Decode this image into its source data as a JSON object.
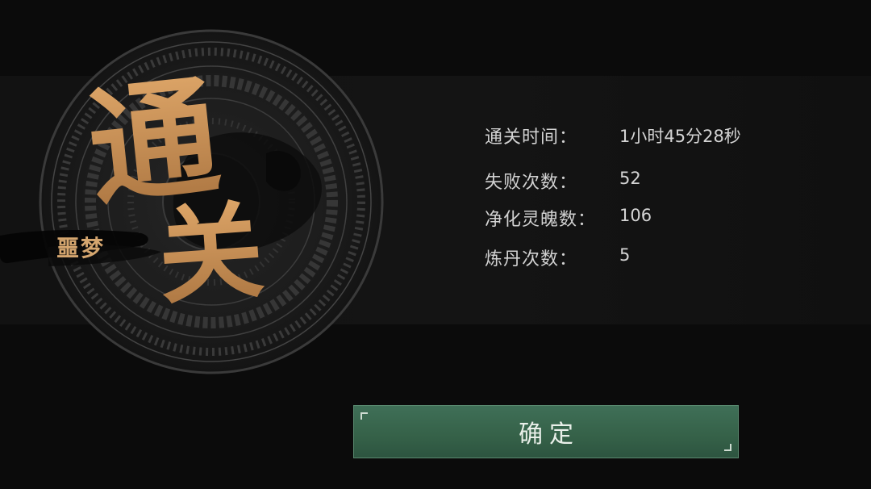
{
  "result": {
    "title_char_1": "通",
    "title_char_2": "关",
    "difficulty": "噩梦"
  },
  "stats": [
    {
      "label": "通关时间：",
      "value": "1小时45分28秒"
    },
    {
      "label": "失败次数：",
      "value": "52"
    },
    {
      "label": "净化灵魄数：",
      "value": "106"
    },
    {
      "label": "炼丹次数：",
      "value": "5"
    }
  ],
  "confirm_button": {
    "label": "确定"
  },
  "colors": {
    "gold": "#c8935a",
    "button_green": "#3a6a50",
    "background": "#0b0b0b"
  }
}
